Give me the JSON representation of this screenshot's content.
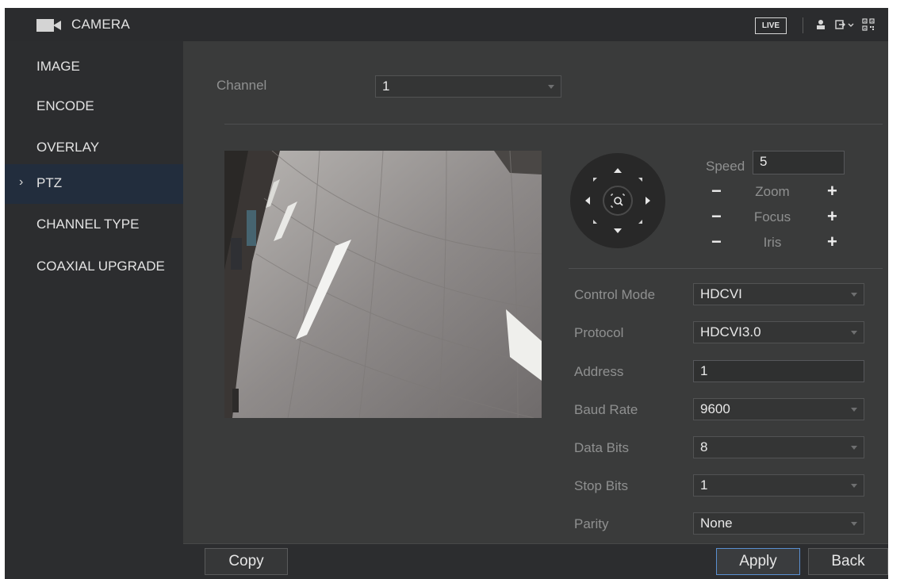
{
  "app": {
    "title": "CAMERA"
  },
  "topbar": {
    "live_label": "LIVE"
  },
  "sidebar": {
    "items": [
      {
        "label": "IMAGE"
      },
      {
        "label": "ENCODE"
      },
      {
        "label": "OVERLAY"
      },
      {
        "label": "PTZ",
        "active": true
      },
      {
        "label": "CHANNEL TYPE"
      },
      {
        "label": "COAXIAL UPGRADE"
      }
    ]
  },
  "channel": {
    "label": "Channel",
    "value": "1"
  },
  "ptz": {
    "speed_label": "Speed",
    "speed_value": "5",
    "zoom_label": "Zoom",
    "focus_label": "Focus",
    "iris_label": "Iris",
    "minus": "−",
    "plus": "+"
  },
  "form": {
    "control_mode": {
      "label": "Control Mode",
      "value": "HDCVI"
    },
    "protocol": {
      "label": "Protocol",
      "value": "HDCVI3.0"
    },
    "address": {
      "label": "Address",
      "value": "1"
    },
    "baud_rate": {
      "label": "Baud Rate",
      "value": "9600"
    },
    "data_bits": {
      "label": "Data Bits",
      "value": "8"
    },
    "stop_bits": {
      "label": "Stop Bits",
      "value": "1"
    },
    "parity": {
      "label": "Parity",
      "value": "None"
    }
  },
  "buttons": {
    "copy": "Copy",
    "apply": "Apply",
    "back": "Back"
  },
  "colors": {
    "accent": "#5a8fd0",
    "active_nav": "#222d3d"
  },
  "icons": {
    "camera": "camera-icon",
    "user": "user-icon",
    "logout": "logout-icon",
    "qr": "qr-code-icon",
    "ptz_zoom_center": "zoom-area-icon"
  }
}
